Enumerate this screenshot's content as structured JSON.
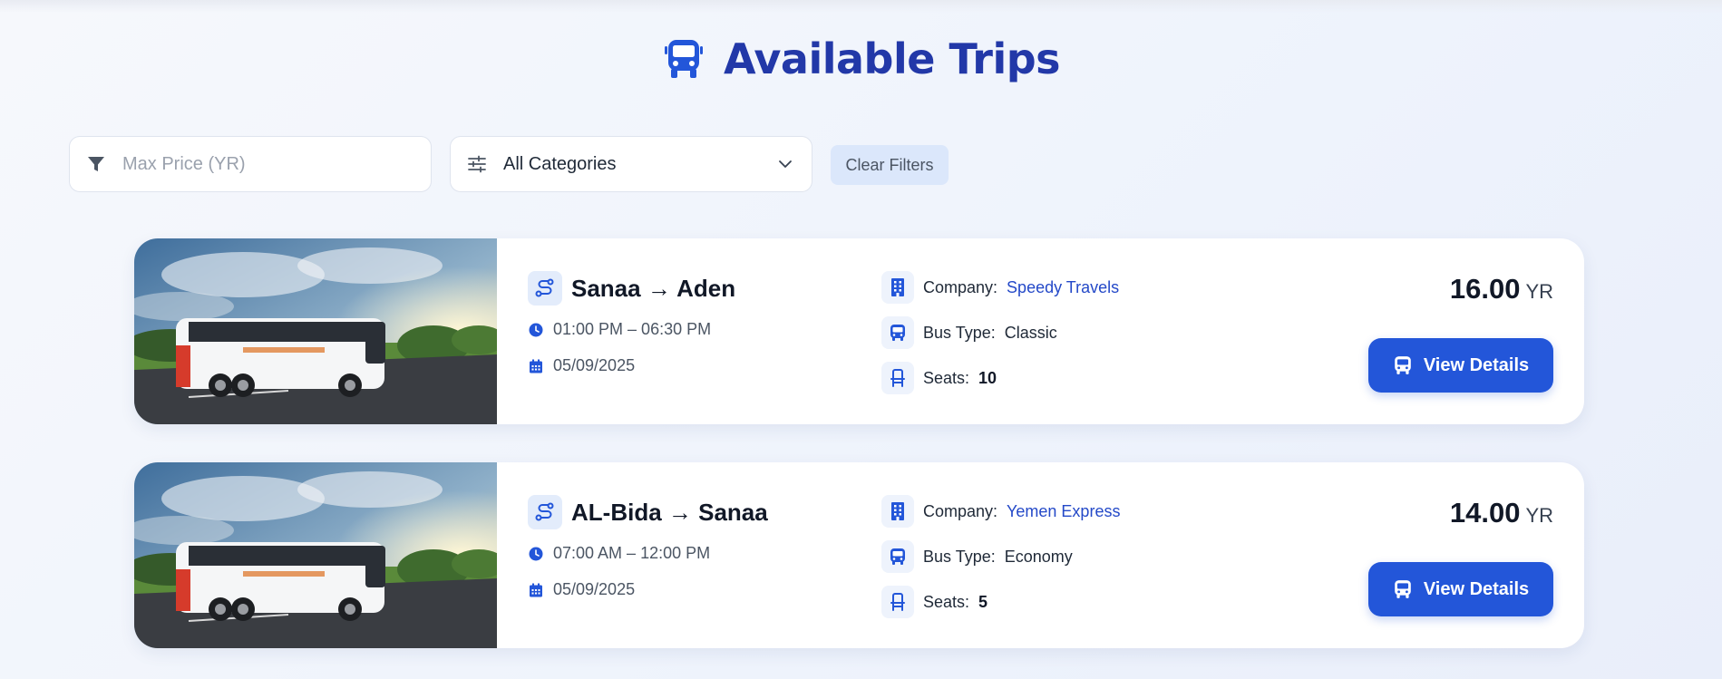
{
  "page": {
    "title": "Available Trips"
  },
  "filters": {
    "price_placeholder": "Max Price (YR)",
    "price_value": "",
    "category_selected": "All Categories",
    "clear_label": "Clear Filters"
  },
  "icons": {
    "header": "bus-icon",
    "price_filter": "filter-icon",
    "category_filter": "sliders-icon",
    "category_dropdown": "chevron-down-icon",
    "route": "route-icon",
    "time": "clock-icon",
    "date": "calendar-icon",
    "company": "building-icon",
    "bus_type": "bus-icon",
    "seats": "seat-icon"
  },
  "colors": {
    "accent": "#2356d9",
    "heading": "#2238a8",
    "link": "#2449c8",
    "icon_bg": "#e3ecfb"
  },
  "trips": [
    {
      "route": "Sanaa → Aden",
      "time": "01:00 PM – 06:30 PM",
      "date": "05/09/2025",
      "company_label": "Company:",
      "company": "Speedy Travels",
      "bus_type_label": "Bus Type:",
      "bus_type": "Classic",
      "seats_label": "Seats:",
      "seats": "10",
      "price": "16.00",
      "currency": "YR",
      "button_label": "View Details"
    },
    {
      "route": "AL-Bida → Sanaa",
      "time": "07:00 AM – 12:00 PM",
      "date": "05/09/2025",
      "company_label": "Company:",
      "company": "Yemen Express",
      "bus_type_label": "Bus Type:",
      "bus_type": "Economy",
      "seats_label": "Seats:",
      "seats": "5",
      "price": "14.00",
      "currency": "YR",
      "button_label": "View Details"
    }
  ]
}
